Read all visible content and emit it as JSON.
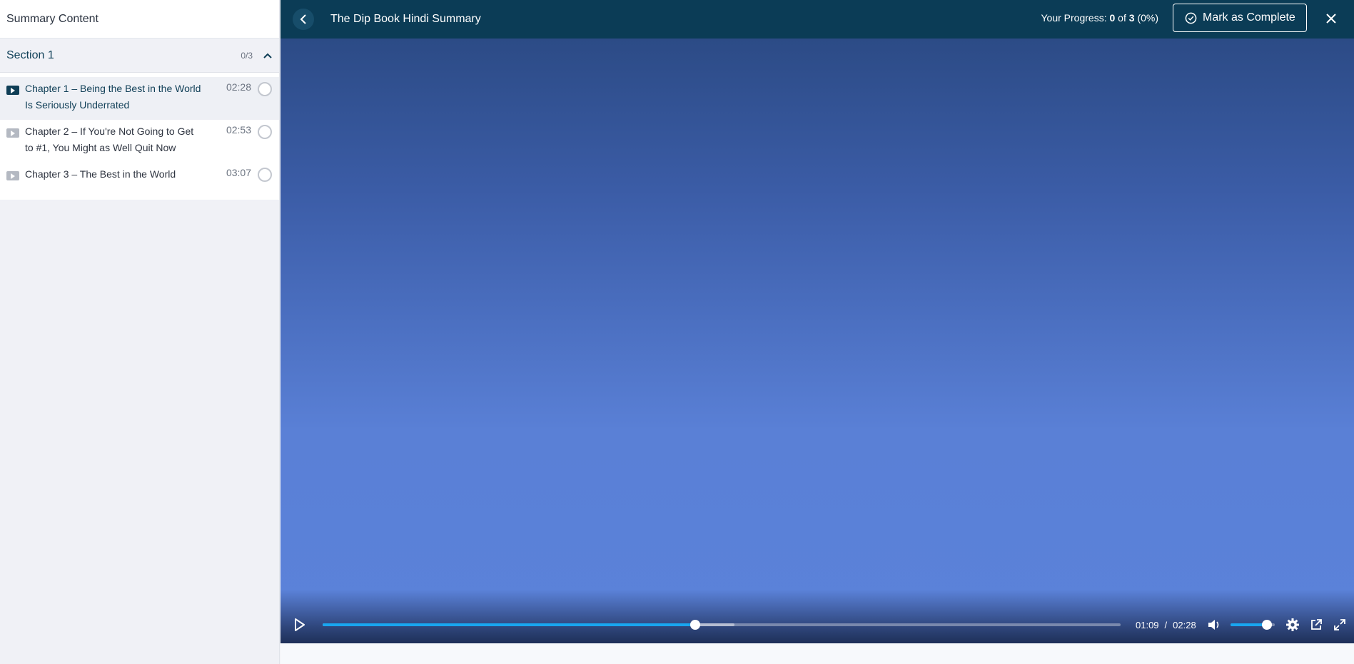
{
  "sidebar": {
    "title": "Summary Content",
    "section": {
      "title": "Section 1",
      "count": "0/3"
    },
    "lessons": [
      {
        "title": "Chapter 1 – Being the Best in the World Is Seriously Underrated",
        "duration": "02:28",
        "active": true
      },
      {
        "title": "Chapter 2 – If You're Not Going to Get to #1, You Might as Well Quit Now",
        "duration": "02:53",
        "active": false
      },
      {
        "title": "Chapter 3 – The Best in the World",
        "duration": "03:07",
        "active": false
      }
    ]
  },
  "header": {
    "title": "The Dip Book Hindi Summary",
    "progress_label": "Your Progress:",
    "progress_done": "0",
    "progress_of": "of",
    "progress_total": "3",
    "progress_pct": "(0%)",
    "complete_label": "Mark as Complete"
  },
  "player": {
    "current_time": "01:09",
    "separator": "/",
    "duration": "02:28",
    "played_fraction": 0.467,
    "buffered_fraction": 0.516,
    "volume_fraction": 0.82,
    "accent": "#18a6f0"
  },
  "icons": {
    "back": "chevron-left-icon",
    "close": "close-icon",
    "check": "check-circle-icon",
    "play": "play-icon",
    "volume": "volume-icon",
    "settings": "gear-icon",
    "popout": "external-link-icon",
    "fullscreen": "fullscreen-icon"
  }
}
